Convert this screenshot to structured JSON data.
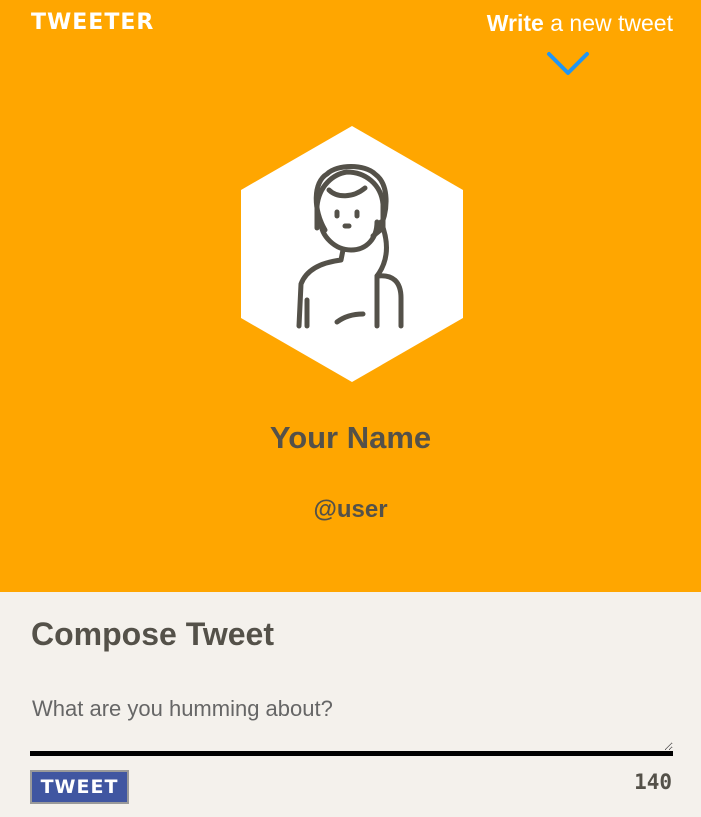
{
  "nav": {
    "brand": "TWEETER",
    "write_strong": "Write",
    "write_rest": " a new tweet",
    "chevron_icon": "chevron-down-icon",
    "accent": "#2196f3"
  },
  "profile": {
    "avatar_icon": "user-avatar-icon",
    "name": "Your Name",
    "handle": "@user"
  },
  "compose": {
    "title": "Compose Tweet",
    "placeholder": "What are you humming about?",
    "value": "",
    "button_label": "TWEET",
    "counter": "140"
  },
  "colors": {
    "header_bg": "#ffa600",
    "page_bg": "#f4f1ec",
    "text": "#545149",
    "button_bg": "#4056a1"
  }
}
